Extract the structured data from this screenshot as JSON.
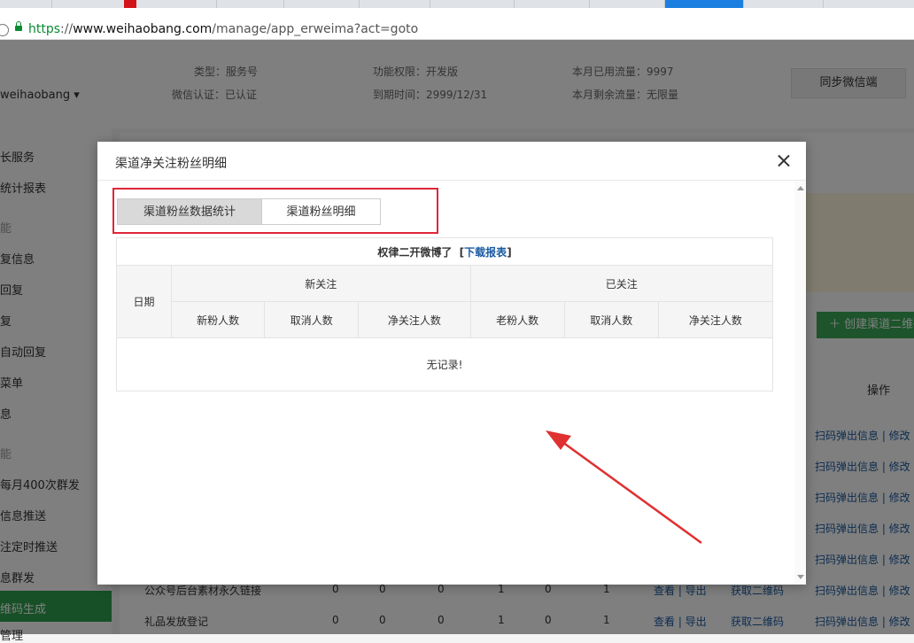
{
  "browser": {
    "url_scheme": "https",
    "url_sep": "://",
    "url_host": "www.weihaobang.com",
    "url_path": "/manage/app_erweima?act=goto"
  },
  "header": {
    "type_label": "类型：服务号",
    "permission_label": "功能权限：开发版",
    "traffic_used_label": "本月已用流量：9997",
    "verify_label": "微信认证：已认证",
    "expiry_label": "到期时间：2999/12/31",
    "traffic_left_label": "本月剩余流量：无限量",
    "sync_button": "同步微信端",
    "account": "weihaobang ▾"
  },
  "sidebar": {
    "items": [
      "长服务",
      "统计报表",
      "能",
      "复信息",
      "回复",
      "复",
      "自动回复",
      "菜单",
      "息",
      "能",
      "每月400次群发",
      "信息推送",
      "注定时推送",
      "息群发",
      "维码生成",
      "管理"
    ],
    "active_index": 14
  },
  "main": {
    "create_button": "创建渠道二维码",
    "op_header": "操作",
    "op_link": "扫码弹出信息 | 修改",
    "rows": [
      {
        "name": "公众号后台素材永久链接",
        "v": [
          "0",
          "0",
          "0",
          "1",
          "0",
          "1"
        ],
        "view": "查看 | 导出",
        "get": "获取二维码"
      },
      {
        "name": "礼品发放登记",
        "v": [
          "0",
          "0",
          "0",
          "1",
          "0",
          "1"
        ],
        "view": "查看 | 导出",
        "get": "获取二维码"
      }
    ]
  },
  "modal": {
    "title": "渠道净关注粉丝明细",
    "tabs": [
      "渠道粉丝数据统计",
      "渠道粉丝明细"
    ],
    "active_tab": 0,
    "table": {
      "caption": "权律二开微博了",
      "download_label": "下载报表",
      "date_header": "日期",
      "group_new": "新关注",
      "group_followed": "已关注",
      "sub_headers": [
        "新粉人数",
        "取消人数",
        "净关注人数",
        "老粉人数",
        "取消人数",
        "净关注人数"
      ],
      "empty_text": "无记录!"
    }
  },
  "colors": {
    "accent_green": "#2fa14f",
    "highlight_red": "#e0263a",
    "link_blue": "#1a5aa0"
  }
}
